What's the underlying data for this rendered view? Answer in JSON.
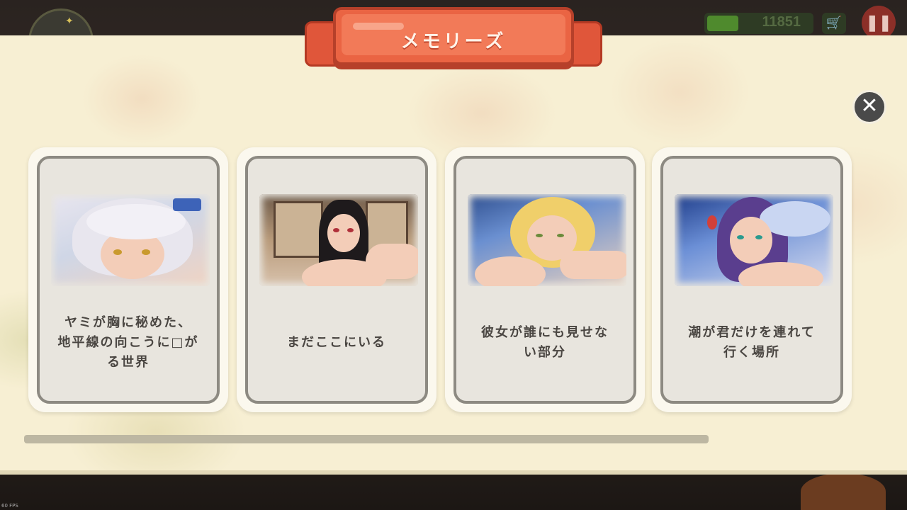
{
  "hud": {
    "money": "11851",
    "fps": "60 FPS"
  },
  "panel": {
    "title": "メモリーズ"
  },
  "cards": [
    {
      "caption": "ヤミが胸に秘めた、\n地平線の向こうに□が\nる世界"
    },
    {
      "caption": "まだここにいる"
    },
    {
      "caption": "彼女が誰にも見せな\nい部分"
    },
    {
      "caption": "潮が君だけを連れて\n行く場所"
    }
  ],
  "scrollbar": {
    "position": 0.0
  }
}
